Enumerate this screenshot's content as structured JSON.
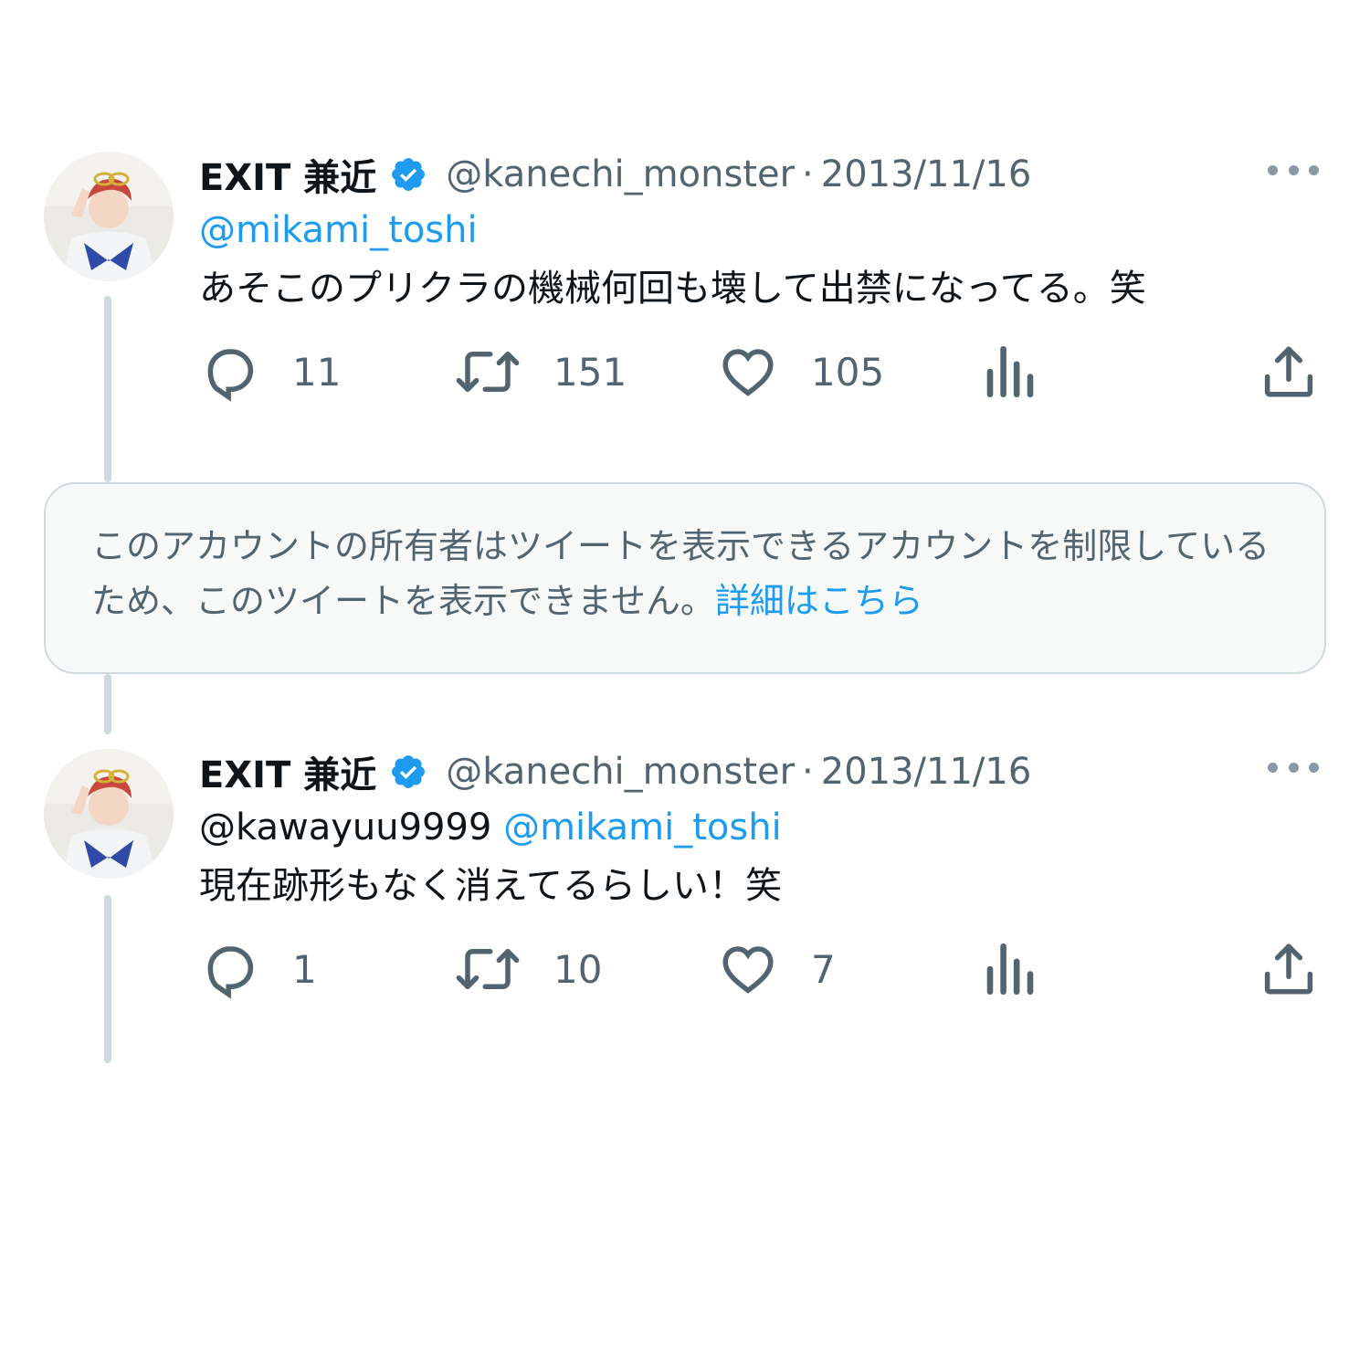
{
  "colors": {
    "text_primary": "#0f1419",
    "text_secondary": "#536471",
    "accent": "#1d9bf0",
    "thread_line": "#cfd9de",
    "notice_bg": "#f7f9f9"
  },
  "tweets": [
    {
      "display_name": "EXIT 兼近",
      "verified_icon": "verified-badge-icon",
      "handle": "@kanechi_monster",
      "separator": "·",
      "date": "2013/11/16",
      "mention_line": [
        "@mikami_toshi"
      ],
      "text": "あそこのプリクラの機械何回も壊して出禁になってる。笑",
      "counts": {
        "replies": "11",
        "retweets": "151",
        "likes": "105"
      }
    },
    {
      "display_name": "EXIT 兼近",
      "verified_icon": "verified-badge-icon",
      "handle": "@kanechi_monster",
      "separator": "·",
      "date": "2013/11/16",
      "mention_plain": "@kawayuu9999",
      "mention_link": "@mikami_toshi",
      "text": "現在跡形もなく消えてるらしい！笑",
      "counts": {
        "replies": "1",
        "retweets": "10",
        "likes": "7"
      }
    }
  ],
  "notice": {
    "text": "このアカウントの所有者はツイートを表示できるアカウントを制限しているため、このツイートを表示できません。",
    "link": "詳細はこちら"
  },
  "icons": [
    "reply-icon",
    "retweet-icon",
    "like-icon",
    "analytics-icon",
    "share-icon",
    "more-icon"
  ]
}
